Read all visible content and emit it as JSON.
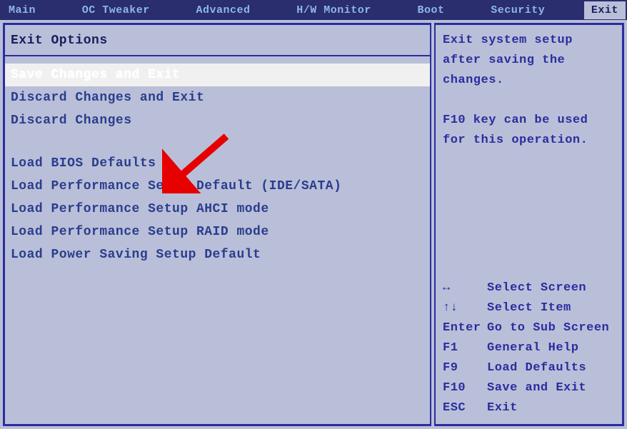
{
  "tabs": {
    "items": [
      "Main",
      "OC Tweaker",
      "Advanced",
      "H/W Monitor",
      "Boot",
      "Security",
      "Exit"
    ],
    "selected_index": 6
  },
  "left_panel": {
    "title": "Exit Options",
    "group1": [
      "Save Changes and Exit",
      "Discard Changes and Exit",
      "Discard Changes"
    ],
    "group2": [
      "Load BIOS Defaults",
      "Load Performance Setup Default (IDE/SATA)",
      "Load Performance Setup AHCI mode",
      "Load Performance Setup RAID mode",
      "Load Power Saving Setup Default"
    ],
    "highlighted_index": 0
  },
  "right_panel": {
    "help_line1": "Exit system setup",
    "help_line2": "after saving the",
    "help_line3": "changes.",
    "help_line4": "F10 key can be used",
    "help_line5": "for this operation.",
    "nav": [
      {
        "key": "↔",
        "desc": "Select Screen"
      },
      {
        "key": "↑↓",
        "desc": "Select Item"
      },
      {
        "key": "Enter",
        "desc": "Go to Sub Screen"
      },
      {
        "key": "F1",
        "desc": "General Help"
      },
      {
        "key": "F9",
        "desc": "Load Defaults"
      },
      {
        "key": "F10",
        "desc": "Save and Exit"
      },
      {
        "key": "ESC",
        "desc": "Exit"
      }
    ]
  }
}
